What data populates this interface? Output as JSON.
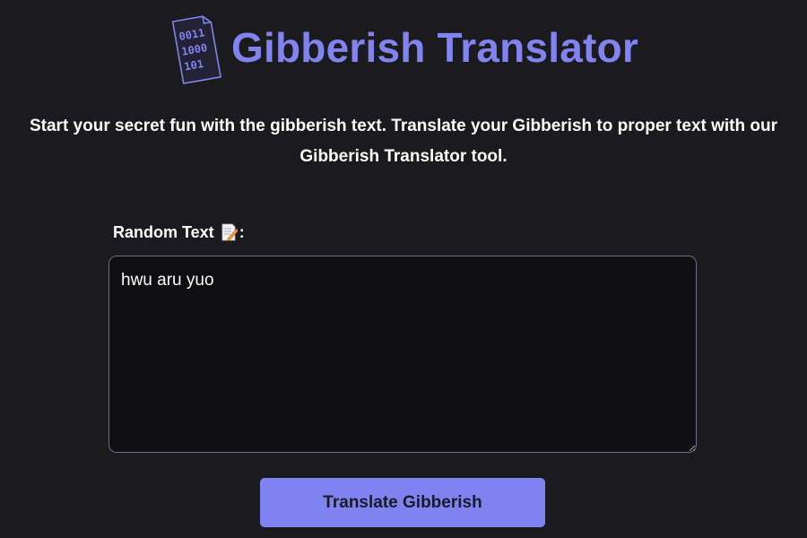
{
  "header": {
    "title": "Gibberish Translator",
    "logo_icon": "binary-document-icon",
    "logo_lines": [
      "0011",
      "1000",
      "101"
    ],
    "accent_color": "#8083f0"
  },
  "intro": {
    "text": "Start your secret fun with the gibberish text. Translate your Gibberish to proper text with our Gibberish Translator tool."
  },
  "form": {
    "input_label": "Random Text",
    "input_label_icon": "memo-icon",
    "input_label_suffix": ":",
    "input_value": "hwu aru yuo",
    "submit_label": "Translate Gibberish",
    "button_color": "#7f83f2"
  }
}
